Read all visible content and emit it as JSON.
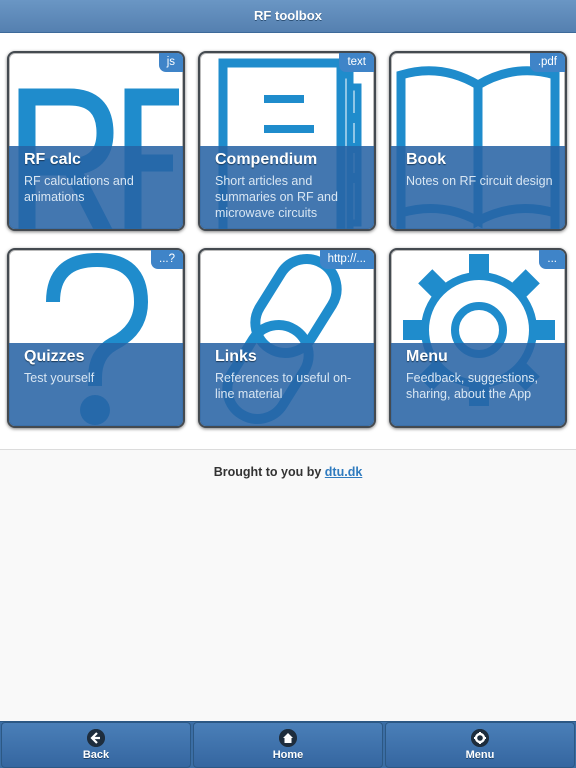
{
  "header": {
    "title": "RF toolbox"
  },
  "tiles": [
    {
      "title": "RF calc",
      "desc": "RF calculations and animations",
      "badge": "js",
      "icon": "rf-letters-icon"
    },
    {
      "title": "Compendium",
      "desc": "Short articles and summaries on RF and microwave circuits",
      "badge": "text",
      "icon": "document-icon"
    },
    {
      "title": "Book",
      "desc": "Notes on RF circuit design",
      "badge": ".pdf",
      "icon": "open-book-icon"
    },
    {
      "title": "Quizzes",
      "desc": "Test yourself",
      "badge": "...?",
      "icon": "question-mark-icon"
    },
    {
      "title": "Links",
      "desc": "References to useful on-line material",
      "badge": "http://...",
      "icon": "chain-link-icon"
    },
    {
      "title": "Menu",
      "desc": "Feedback, suggestions, sharing, about the App",
      "badge": "...",
      "icon": "gear-icon"
    }
  ],
  "credit": {
    "text": "Brought to you by",
    "link": "dtu.dk"
  },
  "footer": {
    "back": "Back",
    "home": "Home",
    "menu": "Menu"
  },
  "colors": {
    "accent": "#3f84c8",
    "icon": "#1f8ccc",
    "overlay": "#2864a5",
    "footer": "#3b6ea5"
  }
}
